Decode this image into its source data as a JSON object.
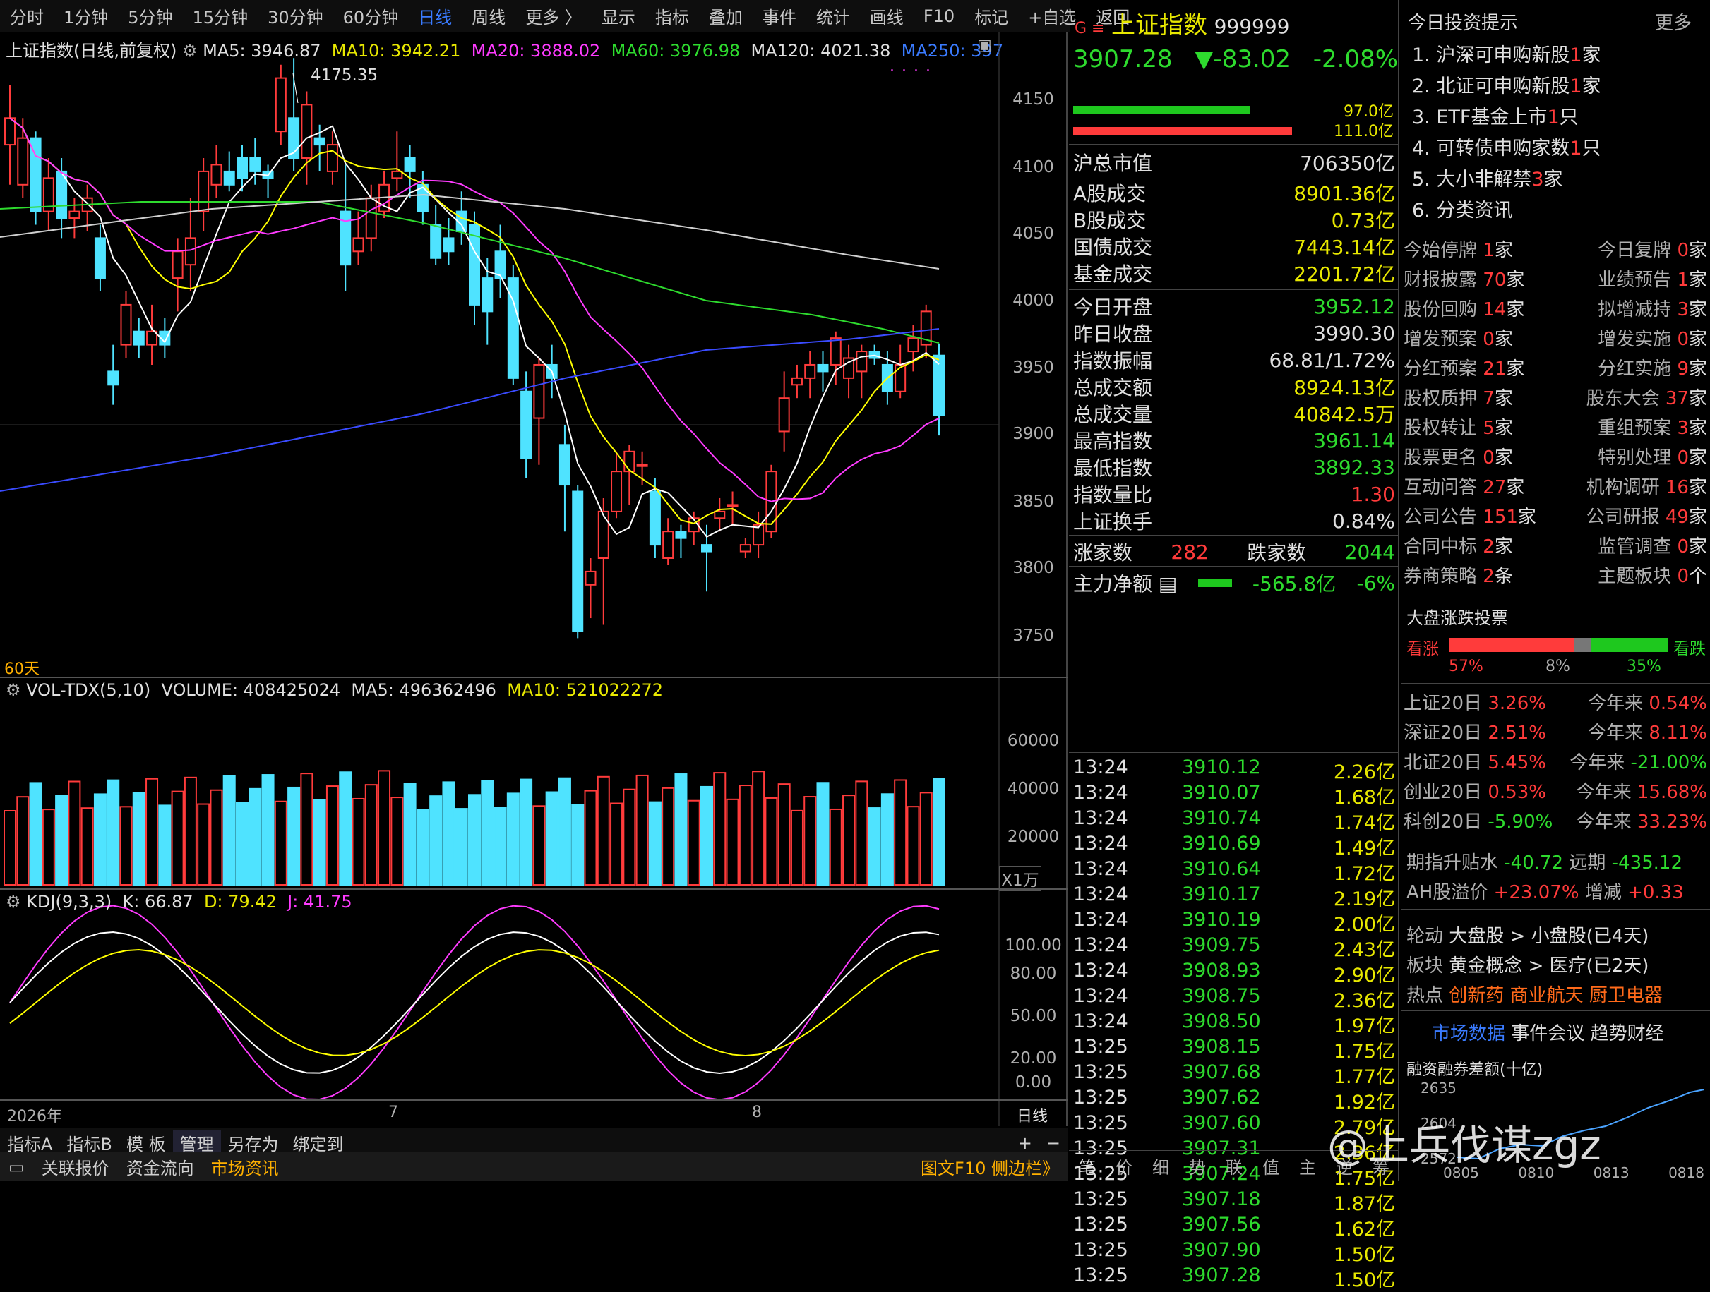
{
  "toolbar": {
    "items": [
      "分时",
      "1分钟",
      "5分钟",
      "15分钟",
      "30分钟",
      "60分钟",
      "日线",
      "周线",
      "更多 〉"
    ],
    "right_items": [
      "显示",
      "指标",
      "叠加",
      "事件",
      "统计",
      "画线",
      "F10",
      "标记",
      "+自选",
      "返回"
    ]
  },
  "kline_panel": {
    "title": "上证指数(日线,前复权)",
    "ma5": "MA5: 3946.87",
    "ma10": "MA10: 3942.21",
    "ma20": "MA20: 3888.02",
    "ma60": "MA60: 3976.98",
    "ma120": "MA120: 4021.38",
    "ma250": "MA250: 397",
    "high_label": "4175.35",
    "period_label": "60天",
    "price_axis": [
      "4150",
      "4100",
      "4050",
      "4000",
      "3950",
      "3900",
      "3850",
      "3800",
      "3750"
    ]
  },
  "vol_panel": {
    "title": "VOL-TDX(5,10)",
    "volume": "VOLUME: 408425024",
    "ma5": "MA5: 496362496",
    "ma10": "MA10: 521022272",
    "axis": [
      "60000",
      "40000",
      "20000"
    ],
    "unit": "X1万"
  },
  "kdj_panel": {
    "title": "KDJ(9,3,3)",
    "k": "K: 66.87",
    "d": "D: 79.42",
    "j": "J: 41.75",
    "axis": [
      "100.00",
      "80.00",
      "50.00",
      "20.00",
      "0.00"
    ]
  },
  "date_axis": {
    "year": "2026年",
    "m7": "7",
    "m8": "8",
    "mode": "日线"
  },
  "bottom_tabs": [
    "指标A",
    "指标B",
    "模 板",
    "管理",
    "另存为",
    "绑定到"
  ],
  "status_bar": {
    "items": [
      "关联报价",
      "资金流向",
      "市场资讯"
    ],
    "right": "图文F10 侧边栏》"
  },
  "quote": {
    "name": "上证指数",
    "code": "999999",
    "price": "3907.28",
    "change": "▼-83.02",
    "pct": "-2.08%",
    "buy_amt": "97.0亿",
    "sell_amt": "111.0亿",
    "rows": [
      {
        "label": "沪总市值",
        "value": "706350亿"
      },
      {
        "label": "A股成交",
        "value": "8901.36亿"
      },
      {
        "label": "B股成交",
        "value": "0.73亿"
      },
      {
        "label": "国债成交",
        "value": "7443.14亿"
      },
      {
        "label": "基金成交",
        "value": "2201.72亿"
      }
    ],
    "rows2": [
      {
        "label": "今日开盘",
        "value": "3952.12"
      },
      {
        "label": "昨日收盘",
        "value": "3990.30"
      },
      {
        "label": "指数振幅",
        "value": "68.81/1.72%"
      },
      {
        "label": "总成交额",
        "value": "8924.13亿"
      },
      {
        "label": "总成交量",
        "value": "40842.5万"
      },
      {
        "label": "最高指数",
        "value": "3961.14"
      },
      {
        "label": "最低指数",
        "value": "3892.33"
      },
      {
        "label": "指数量比",
        "value": "1.30"
      },
      {
        "label": "上证换手",
        "value": "0.84%"
      }
    ],
    "up_label": "涨家数",
    "up": "282",
    "down_label": "跌家数",
    "down": "2044",
    "flow_label": "主力净额",
    "flow": "-565.8亿",
    "flow_pct": "-6%"
  },
  "ticks": [
    [
      "13:24",
      "3910.12",
      "2.26亿"
    ],
    [
      "13:24",
      "3910.07",
      "1.68亿"
    ],
    [
      "13:24",
      "3910.74",
      "1.74亿"
    ],
    [
      "13:24",
      "3910.69",
      "1.49亿"
    ],
    [
      "13:24",
      "3910.64",
      "1.72亿"
    ],
    [
      "13:24",
      "3910.17",
      "2.19亿"
    ],
    [
      "13:24",
      "3910.19",
      "2.00亿"
    ],
    [
      "13:24",
      "3909.75",
      "2.43亿"
    ],
    [
      "13:24",
      "3908.93",
      "2.90亿"
    ],
    [
      "13:24",
      "3908.75",
      "2.36亿"
    ],
    [
      "13:24",
      "3908.50",
      "1.97亿"
    ],
    [
      "13:25",
      "3908.15",
      "1.75亿"
    ],
    [
      "13:25",
      "3907.68",
      "1.77亿"
    ],
    [
      "13:25",
      "3907.62",
      "1.92亿"
    ],
    [
      "13:25",
      "3907.60",
      "2.79亿"
    ],
    [
      "13:25",
      "3907.31",
      "2.36亿"
    ],
    [
      "13:25",
      "3907.24",
      "1.75亿"
    ],
    [
      "13:25",
      "3907.18",
      "1.87亿"
    ],
    [
      "13:25",
      "3907.56",
      "1.62亿"
    ],
    [
      "13:25",
      "3907.90",
      "1.50亿"
    ],
    [
      "13:25",
      "3907.28",
      "1.50亿"
    ]
  ],
  "right_tabs": [
    "笔",
    "价",
    "细",
    "势",
    "联",
    "值",
    "主",
    "逆",
    "筹"
  ],
  "tips": {
    "title": "今日投资提示",
    "more": "更多",
    "items": [
      {
        "text": "1. 沪深可申购新股",
        "num": "1",
        "unit": "家"
      },
      {
        "text": "2. 北证可申购新股",
        "num": "1",
        "unit": "家"
      },
      {
        "text": "3. ETF基金上市",
        "num": "1",
        "unit": "只"
      },
      {
        "text": "4. 可转债申购家数",
        "num": "1",
        "unit": "只"
      },
      {
        "text": "5. 大小非解禁",
        "num": "3",
        "unit": "家"
      },
      {
        "text": "6. 分类资讯",
        "num": "",
        "unit": ""
      }
    ],
    "grid": [
      [
        "今始停牌",
        "1家",
        "今日复牌",
        "0家"
      ],
      [
        "财报披露",
        "70家",
        "业绩预告",
        "1家"
      ],
      [
        "股份回购",
        "14家",
        "拟增减持",
        "3家"
      ],
      [
        "增发预案",
        "0家",
        "增发实施",
        "0家"
      ],
      [
        "分红预案",
        "21家",
        "分红实施",
        "9家"
      ],
      [
        "股权质押",
        "7家",
        "股东大会",
        "37家"
      ],
      [
        "股权转让",
        "5家",
        "重组预案",
        "3家"
      ],
      [
        "股票更名",
        "0家",
        "特别处理",
        "0家"
      ],
      [
        "互动问答",
        "27家",
        "机构调研",
        "16家"
      ],
      [
        "公司公告",
        "151家",
        "公司研报",
        "49家"
      ],
      [
        "合同中标",
        "2家",
        "监管调查",
        "0家"
      ],
      [
        "券商策略",
        "2条",
        "主题板块",
        "0个"
      ]
    ]
  },
  "vote": {
    "title": "大盘涨跌投票",
    "up_label": "看涨",
    "down_label": "看跌",
    "up_pct": "57%",
    "mid_pct": "8%",
    "down_pct": "35%"
  },
  "perf": [
    [
      "上证20日",
      "3.26%",
      "今年来",
      "0.54%"
    ],
    [
      "深证20日",
      "2.51%",
      "今年来",
      "8.11%"
    ],
    [
      "北证20日",
      "5.45%",
      "今年来",
      "-21.00%"
    ],
    [
      "创业20日",
      "0.53%",
      "今年来",
      "15.68%"
    ],
    [
      "科创20日",
      "-5.90%",
      "今年来",
      "33.23%"
    ]
  ],
  "futures": {
    "label1": "期指升贴水",
    "v1": "-40.72",
    "label2": "远期",
    "v2": "-435.12"
  },
  "ah": {
    "label": "AH股溢价",
    "v": "+23.07%",
    "label2": "增减",
    "v2": "+0.33"
  },
  "rotation": {
    "label": "轮动",
    "a": "大盘股",
    "b": "小盘股(已4天)"
  },
  "sector": {
    "label": "板块",
    "a": "黄金概念",
    "b": "医疗(已2天)"
  },
  "hot": {
    "label": "热点",
    "items": [
      "创新药",
      "商业航天",
      "厨卫电器"
    ]
  },
  "links": [
    "市场数据",
    "事件会议",
    "趋势财经"
  ],
  "margin": {
    "title": "融资融券差额(十亿)",
    "y1": "2635",
    "y2": "2604",
    "y3": "2572",
    "x": [
      "0805",
      "0810",
      "0813",
      "0818"
    ]
  },
  "watermark": "@上兵伐谋zgz",
  "colors": {
    "up": "#ff3b3b",
    "down": "#4fe3ff",
    "ma5": "#ffffff",
    "ma10": "#ffff00",
    "ma20": "#ff3bff",
    "ma60": "#2edb2e",
    "ma120": "#d0d0d0",
    "ma250": "#3a4bff"
  }
}
